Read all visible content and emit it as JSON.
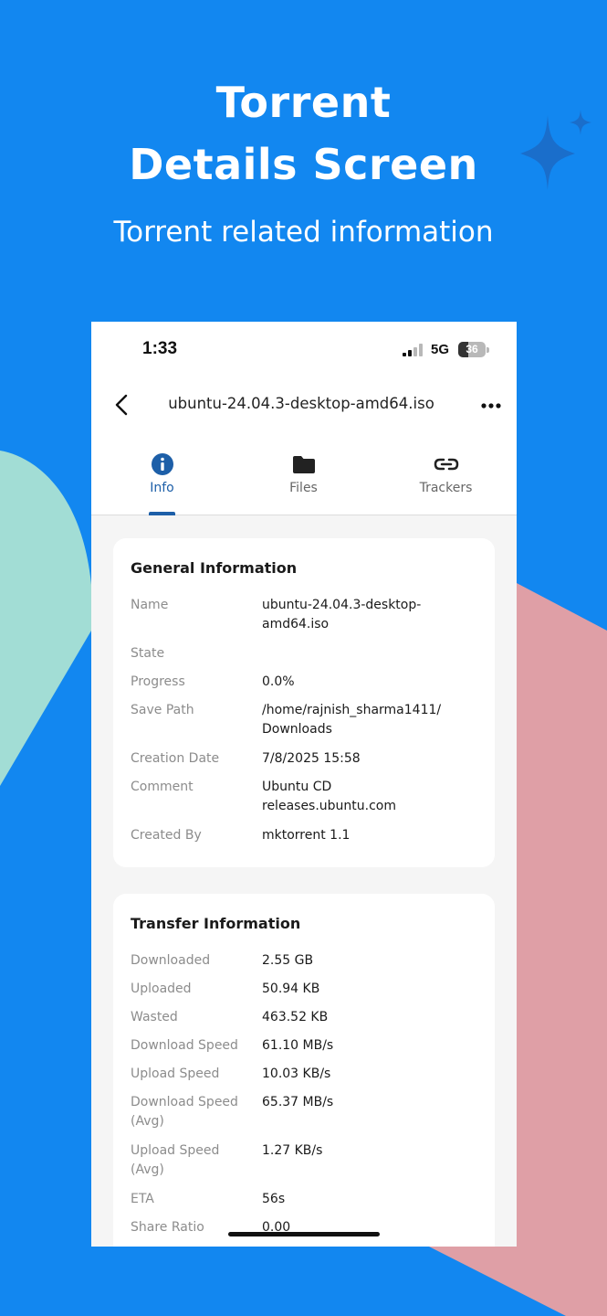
{
  "hero": {
    "title_line1": "Torrent",
    "title_line2": "Details Screen",
    "subtitle": "Torrent related information"
  },
  "colors": {
    "background": "#1287f0",
    "accent": "#1d5fa8",
    "teal_shape": "#a2ddd5",
    "pink_shape": "#df9fa6",
    "sparkle": "#1a6ecb"
  },
  "status_bar": {
    "time": "1:33",
    "network": "5G",
    "battery": "36",
    "battery_level": 0.36,
    "signal_icon": "cellular-signal-icon"
  },
  "app_bar": {
    "title": "ubuntu-24.04.3-desktop-amd64.iso",
    "back_icon": "back-chevron-icon",
    "more_icon": "more-horizontal-icon"
  },
  "tabs": [
    {
      "label": "Info",
      "icon": "info-icon",
      "active": true
    },
    {
      "label": "Files",
      "icon": "folder-icon",
      "active": false
    },
    {
      "label": "Trackers",
      "icon": "link-icon",
      "active": false
    }
  ],
  "general": {
    "title": "General Information",
    "rows": [
      {
        "label": "Name",
        "value_line1": "ubuntu-24.04.3-desktop-",
        "value_line2": "amd64.iso"
      },
      {
        "label": "State",
        "value": ""
      },
      {
        "label": "Progress",
        "value": "0.0%"
      },
      {
        "label": "Save Path",
        "value_line1": "/home/rajnish_sharma1411/",
        "value_line2": "Downloads"
      },
      {
        "label": "Creation Date",
        "value": "7/8/2025 15:58"
      },
      {
        "label": "Comment",
        "value_line1": "Ubuntu CD",
        "value_line2": "releases.ubuntu.com"
      },
      {
        "label": "Created By",
        "value": "mktorrent 1.1"
      }
    ]
  },
  "transfer": {
    "title": "Transfer Information",
    "rows": [
      {
        "label": "Downloaded",
        "value": "2.55 GB"
      },
      {
        "label": "Uploaded",
        "value": "50.94 KB"
      },
      {
        "label": "Wasted",
        "value": "463.52 KB"
      },
      {
        "label": "Download Speed",
        "value": "61.10 MB/s"
      },
      {
        "label": "Upload Speed",
        "value": "10.03 KB/s"
      },
      {
        "label_line1": "Download Speed",
        "label_line2": "(Avg)",
        "value": "65.37 MB/s"
      },
      {
        "label_line1": "Upload Speed",
        "label_line2": "(Avg)",
        "value": "1.27 KB/s"
      },
      {
        "label": "ETA",
        "value": "56s"
      },
      {
        "label": "Share Ratio",
        "value": "0.00"
      }
    ]
  }
}
